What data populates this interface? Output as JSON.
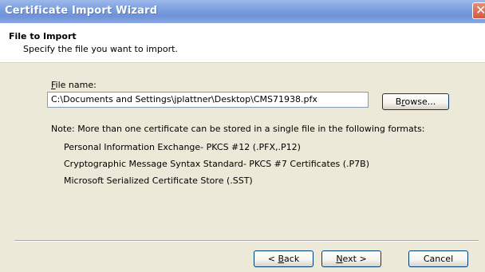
{
  "window": {
    "title": "Certificate Import Wizard"
  },
  "header": {
    "title": "File to Import",
    "subtitle": "Specify the file you want to import."
  },
  "file": {
    "label_mnemonic": "F",
    "label_rest": "ile name:",
    "value": "C:\\Documents and Settings\\jplattner\\Desktop\\CMS71938.pfx",
    "browse_pre": "B",
    "browse_mnemonic": "r",
    "browse_post": "owse..."
  },
  "note": "Note:  More than one certificate can be stored in a single file in the following formats:",
  "formats": [
    "Personal Information Exchange- PKCS #12 (.PFX,.P12)",
    "Cryptographic Message Syntax Standard- PKCS #7 Certificates (.P7B)",
    "Microsoft Serialized Certificate Store (.SST)"
  ],
  "buttons": {
    "back_pre": "< ",
    "back_mnemonic": "B",
    "back_post": "ack",
    "next_mnemonic": "N",
    "next_post": "ext >",
    "cancel": "Cancel"
  },
  "colors": {
    "titlebar": "#7c9fe0",
    "dialog_bg": "#ece9d8",
    "close_button": "#d05a3f"
  }
}
